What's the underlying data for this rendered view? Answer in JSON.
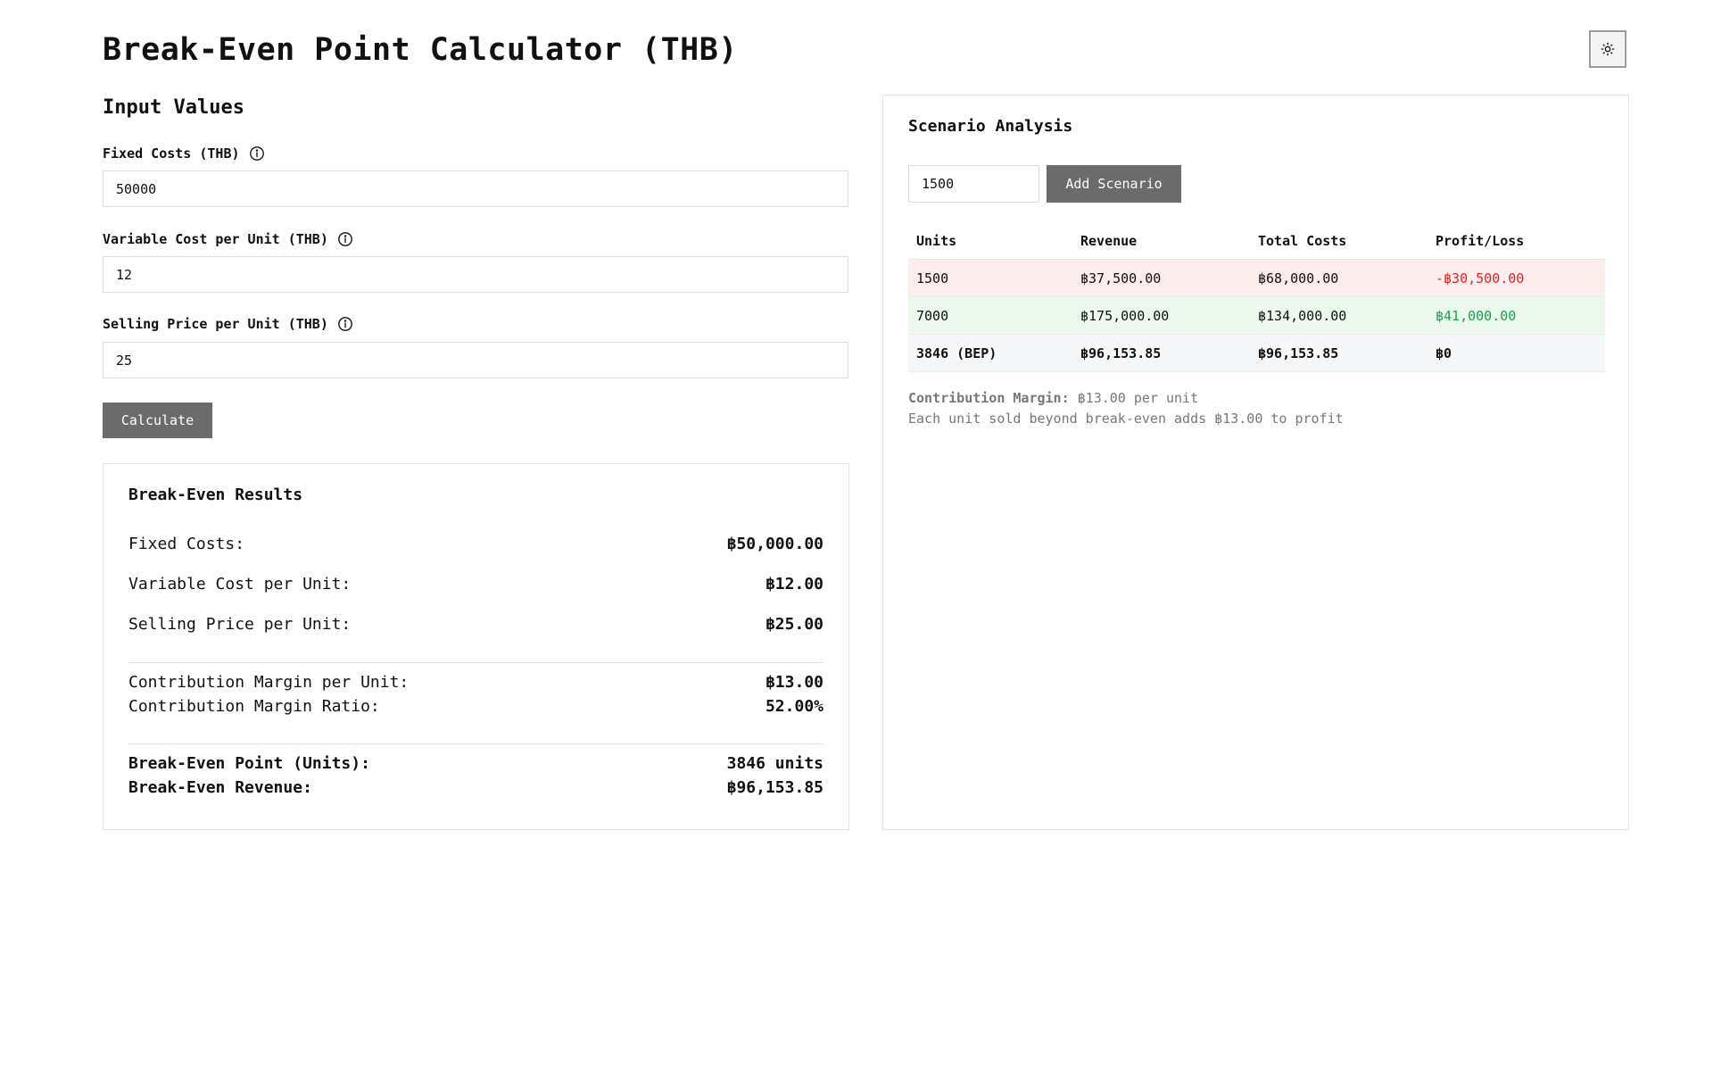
{
  "header": {
    "title": "Break-Even Point Calculator (THB)"
  },
  "theme_toggle": {
    "icon": "sun-icon"
  },
  "inputs": {
    "heading": "Input Values",
    "fixed_costs": {
      "label": "Fixed Costs (THB)",
      "value": "50000"
    },
    "variable_cost": {
      "label": "Variable Cost per Unit (THB)",
      "value": "12"
    },
    "selling_price": {
      "label": "Selling Price per Unit (THB)",
      "value": "25"
    },
    "calculate_label": "Calculate"
  },
  "results": {
    "title": "Break-Even Results",
    "fixed_costs": {
      "label": "Fixed Costs:",
      "value": "฿50,000.00"
    },
    "variable_cost": {
      "label": "Variable Cost per Unit:",
      "value": "฿12.00"
    },
    "selling_price": {
      "label": "Selling Price per Unit:",
      "value": "฿25.00"
    },
    "cm_unit": {
      "label": "Contribution Margin per Unit:",
      "value": "฿13.00"
    },
    "cm_ratio": {
      "label": "Contribution Margin Ratio:",
      "value": "52.00%"
    },
    "bep_units": {
      "label": "Break-Even Point (Units):",
      "value": "3846 units"
    },
    "bep_revenue": {
      "label": "Break-Even Revenue:",
      "value": "฿96,153.85"
    }
  },
  "scenario": {
    "title": "Scenario Analysis",
    "units_value": "1500",
    "add_label": "Add Scenario",
    "columns": [
      "Units",
      "Revenue",
      "Total Costs",
      "Profit/Loss"
    ],
    "rows": [
      {
        "units": "1500",
        "revenue": "฿37,500.00",
        "total_costs": "฿68,000.00",
        "profit": "-฿30,500.00"
      },
      {
        "units": "7000",
        "revenue": "฿175,000.00",
        "total_costs": "฿134,000.00",
        "profit": "฿41,000.00"
      },
      {
        "units": "3846 (BEP)",
        "revenue": "฿96,153.85",
        "total_costs": "฿96,153.85",
        "profit": "฿0"
      }
    ],
    "note_label": "Contribution Margin:",
    "note_value": "฿13.00 per unit",
    "note_line2": "Each unit sold beyond break-even adds ฿13.00 to profit"
  },
  "colors": {
    "loss": "#dc2626",
    "profit": "#16a34a",
    "button": "#6b6b6b"
  }
}
